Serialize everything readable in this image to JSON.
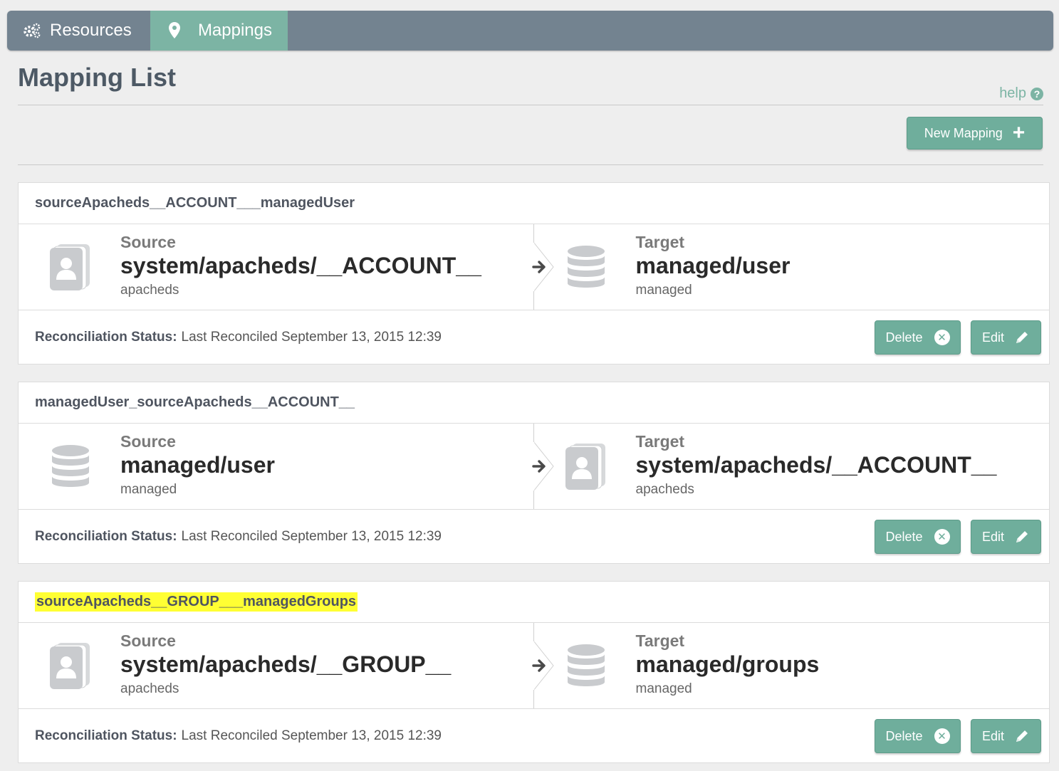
{
  "nav": {
    "tabs": [
      {
        "label": "Resources",
        "icon": "gears-icon",
        "active": false
      },
      {
        "label": "Mappings",
        "icon": "map-marker-icon",
        "active": true
      }
    ]
  },
  "page": {
    "title": "Mapping List",
    "help_label": "help",
    "help_icon_glyph": "?",
    "new_mapping_label": "New Mapping",
    "new_mapping_glyph": "+"
  },
  "colors": {
    "navbar": "#738390",
    "active_tab": "#7cb4a4",
    "button": "#6fae9c",
    "highlight": "#ffff33"
  },
  "mappings": [
    {
      "name": "sourceApacheds__ACCOUNT___managedUser",
      "highlighted": false,
      "source": {
        "label": "Source",
        "path": "system/apacheds/__ACCOUNT__",
        "sub": "apacheds",
        "icon": "address-book-icon"
      },
      "target": {
        "label": "Target",
        "path": "managed/user",
        "sub": "managed",
        "icon": "database-icon"
      },
      "status_label": "Reconciliation Status:",
      "status_text": "Last Reconciled September 13, 2015 12:39",
      "delete_label": "Delete",
      "edit_label": "Edit"
    },
    {
      "name": "managedUser_sourceApacheds__ACCOUNT__",
      "highlighted": false,
      "source": {
        "label": "Source",
        "path": "managed/user",
        "sub": "managed",
        "icon": "database-icon"
      },
      "target": {
        "label": "Target",
        "path": "system/apacheds/__ACCOUNT__",
        "sub": "apacheds",
        "icon": "address-book-icon"
      },
      "status_label": "Reconciliation Status:",
      "status_text": "Last Reconciled September 13, 2015 12:39",
      "delete_label": "Delete",
      "edit_label": "Edit"
    },
    {
      "name": "sourceApacheds__GROUP___managedGroups",
      "highlighted": true,
      "source": {
        "label": "Source",
        "path": "system/apacheds/__GROUP__",
        "sub": "apacheds",
        "icon": "address-book-icon"
      },
      "target": {
        "label": "Target",
        "path": "managed/groups",
        "sub": "managed",
        "icon": "database-icon"
      },
      "status_label": "Reconciliation Status:",
      "status_text": "Last Reconciled September 13, 2015 12:39",
      "delete_label": "Delete",
      "edit_label": "Edit"
    }
  ]
}
